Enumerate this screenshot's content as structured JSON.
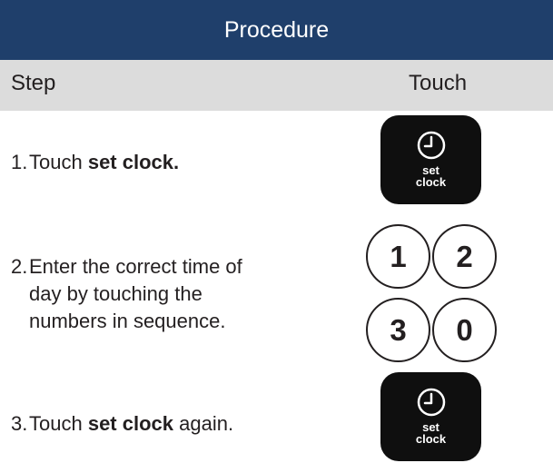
{
  "header": {
    "title": "Procedure"
  },
  "columns": {
    "step": "Step",
    "touch": "Touch"
  },
  "steps": [
    {
      "number": "1.",
      "text_before": "Touch ",
      "bold": "set clock.",
      "text_after": ""
    },
    {
      "number": "2.",
      "lines": [
        "Enter the correct time of",
        "day by touching the",
        "numbers in sequence."
      ]
    },
    {
      "number": "3.",
      "text_before": "Touch ",
      "bold": "set clock",
      "text_after": " again."
    }
  ],
  "keys": {
    "set_clock": {
      "line1": "set",
      "line2": "clock"
    },
    "digits": [
      "1",
      "2",
      "3",
      "0"
    ]
  },
  "colors": {
    "header_bg": "#1f3f6b",
    "column_header_bg": "#dcdcdc",
    "key_bg": "#0f0f0f"
  },
  "icons": [
    "clock-icon"
  ]
}
